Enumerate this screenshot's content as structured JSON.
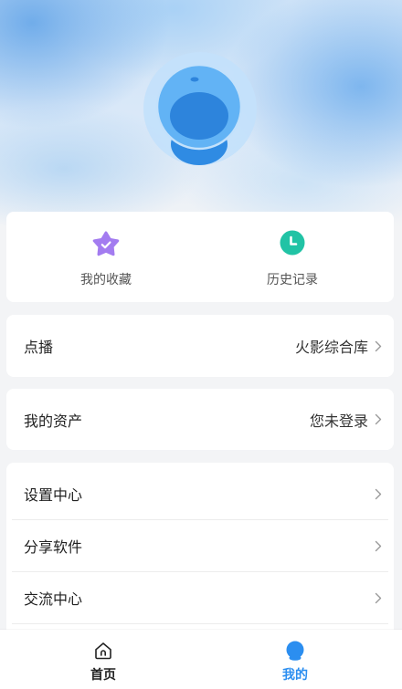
{
  "profile": {
    "avatar_icon": "robot-avatar-icon"
  },
  "quick_actions": [
    {
      "label": "我的收藏",
      "icon": "star-icon"
    },
    {
      "label": "历史记录",
      "icon": "clock-icon"
    }
  ],
  "vod": {
    "label": "点播",
    "value": "火影综合库",
    "icon": "chevron-right-icon"
  },
  "assets": {
    "label": "我的资产",
    "value": "您未登录",
    "icon": "chevron-right-icon"
  },
  "menu": [
    {
      "label": "设置中心",
      "icon": "chevron-right-icon"
    },
    {
      "label": "分享软件",
      "icon": "chevron-right-icon"
    },
    {
      "label": "交流中心",
      "icon": "chevron-right-icon"
    }
  ],
  "tabbar": {
    "items": [
      {
        "label": "首页",
        "icon": "home-icon",
        "active": false
      },
      {
        "label": "我的",
        "icon": "profile-icon",
        "active": true
      }
    ]
  },
  "colors": {
    "accent": "#2b8ef0",
    "star": "#a37cf0",
    "clock": "#21c3a5",
    "background": "#f3f4f6"
  }
}
